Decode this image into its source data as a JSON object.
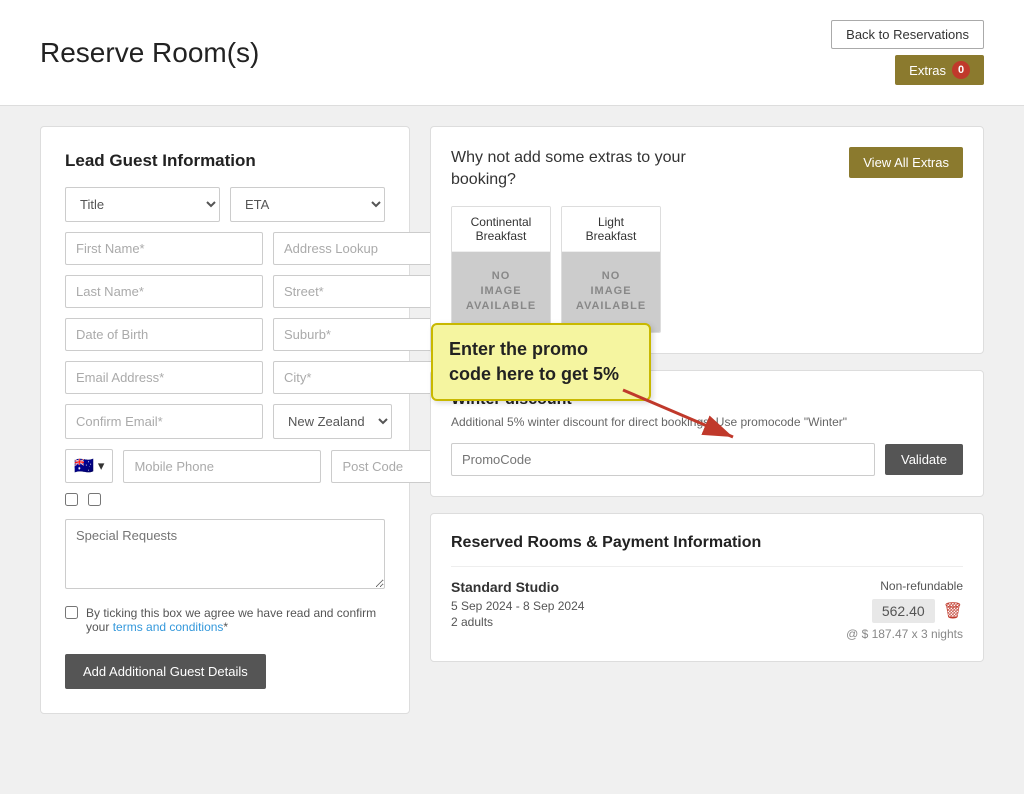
{
  "header": {
    "title": "Reserve Room(s)",
    "btn_back": "Back to Reservations",
    "btn_extras": "Extras",
    "extras_count": "0"
  },
  "lead_guest": {
    "section_title": "Lead Guest Information",
    "title_placeholder": "Title",
    "eta_placeholder": "ETA",
    "first_name_placeholder": "First Name*",
    "address_lookup_placeholder": "Address Lookup",
    "last_name_placeholder": "Last Name*",
    "street_placeholder": "Street*",
    "dob_placeholder": "Date of Birth",
    "suburb_placeholder": "Suburb*",
    "email_placeholder": "Email Address*",
    "city_placeholder": "City*",
    "confirm_email_placeholder": "Confirm Email*",
    "country_value": "New Zealand",
    "mobile_placeholder": "Mobile Phone",
    "postcode_placeholder": "Post Code",
    "special_requests_placeholder": "Special Requests",
    "terms_text": "By ticking this box we agree we have read and confirm your ",
    "terms_link": "terms and conditions",
    "terms_asterisk": "*",
    "btn_add_guest": "Add Additional Guest Details"
  },
  "extras": {
    "heading": "Why not add some extras to your booking?",
    "btn_view_all": "View All Extras",
    "items": [
      {
        "label": "Continental Breakfast",
        "image_text": "NO\nIMAGE\nAVAILABLE"
      },
      {
        "label": "Light Breakfast",
        "image_text": "NO\nIMAGE\nAVAILABLE"
      }
    ]
  },
  "discount": {
    "title": "Winter discount",
    "description": "Additional 5% winter discount for direct bookings. Use promocode \"Winter\"",
    "promo_placeholder": "PromoCode",
    "btn_validate": "Validate",
    "tooltip_text": "Enter the promo code here to get 5%"
  },
  "payment": {
    "title": "Reserved Rooms & Payment Information",
    "room_name": "Standard Studio",
    "refundable_label": "Non-refundable",
    "dates": "5 Sep 2024 - 8 Sep 2024",
    "guests": "2 adults",
    "price": "562.40",
    "per_night": "@ $ 187.47 x 3 nights"
  }
}
